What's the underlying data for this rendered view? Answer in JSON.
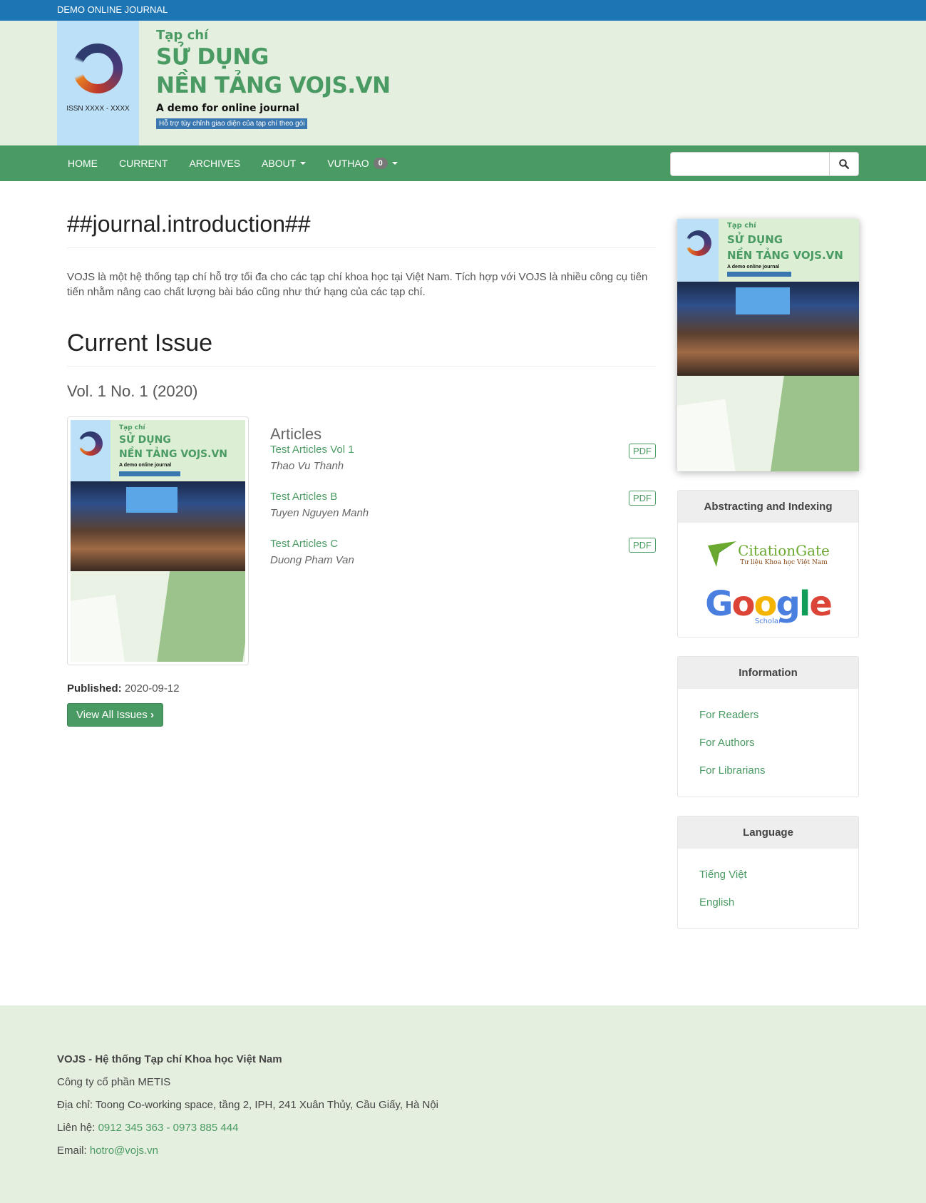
{
  "topbar": {
    "title": "DEMO ONLINE JOURNAL"
  },
  "banner": {
    "issn": "ISSN XXXX - XXXX",
    "tapchi": "Tạp chí",
    "line1": "SỬ DỤNG",
    "line2": "NỀN TẢNG VOJS.VN",
    "demo": "A demo for online journal",
    "badge": "Hỗ trợ tùy chỉnh giao diện của tạp chí theo gói"
  },
  "nav": {
    "items": [
      "HOME",
      "CURRENT",
      "ARCHIVES",
      "ABOUT",
      "VUTHAO"
    ],
    "user_badge": "0",
    "search_placeholder": ""
  },
  "main": {
    "intro_heading": "##journal.introduction##",
    "intro_text": "VOJS là một hệ thống tạp chí hỗ trợ tối đa cho các tạp chí khoa học tại Việt Nam. Tích hợp với VOJS là nhiều công cụ tiên tiến nhằm nâng cao chất lượng bài báo cũng như thứ hạng của các tạp chí.",
    "current_heading": "Current Issue",
    "volume": "Vol. 1 No. 1 (2020)",
    "articles_heading": "Articles",
    "articles": [
      {
        "title": "Test Articles Vol 1",
        "author": "Thao Vu Thanh",
        "galley": "PDF"
      },
      {
        "title": "Test Articles B",
        "author": "Tuyen Nguyen Manh",
        "galley": "PDF"
      },
      {
        "title": "Test Articles C",
        "author": "Duong Pham Van",
        "galley": "PDF"
      }
    ],
    "published_label": "Published:",
    "published_date": "2020-09-12",
    "view_all": "View All Issues"
  },
  "sidebar": {
    "indexing_title": "Abstracting and Indexing",
    "citationgate": {
      "name": "CitationGate",
      "tagline": "Tư liệu Khoa học Việt Nam"
    },
    "google": {
      "name": "Google",
      "sub": "Scholar"
    },
    "information_title": "Information",
    "information_links": [
      "For Readers",
      "For Authors",
      "For Librarians"
    ],
    "language_title": "Language",
    "languages": [
      "Tiếng Việt",
      "English"
    ]
  },
  "footer": {
    "org": "VOJS - Hệ thống Tạp chí Khoa học Việt Nam",
    "company": "Công ty cổ phần METIS",
    "address": "Địa chỉ: Toong Co-working space, tầng 2, IPH, 241 Xuân Thủy, Cầu Giấy, Hà Nội",
    "contact_label": "Liên hệ:",
    "phone1": "0912 345 363",
    "separator": "-",
    "phone2": "0973 885 444",
    "email_label": "Email:",
    "email": "hotro@vojs.vn"
  },
  "colors": {
    "topbar": "#1d75b3",
    "nav": "#4a9b63",
    "header_bg": "#e5efdf",
    "link": "#4a9b63"
  }
}
